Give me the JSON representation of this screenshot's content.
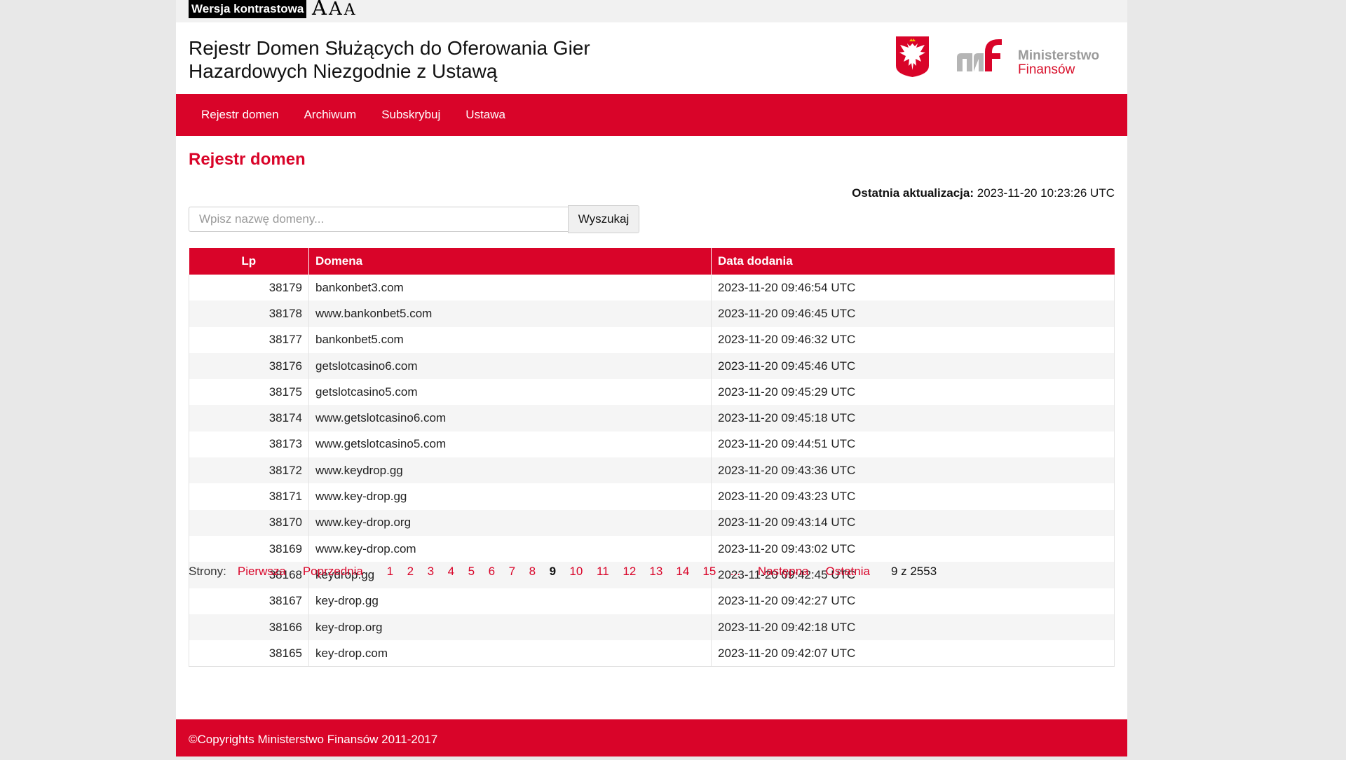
{
  "accessibility": {
    "contrast_label": "Wersja kontrastowa",
    "font_sizes": [
      "A",
      "A",
      "A"
    ]
  },
  "header": {
    "title": "Rejestr Domen Służących do Oferowania Gier Hazardowych Niezgodnie z Ustawą",
    "ministry_line1": "Ministerstwo",
    "ministry_line2": "Finansów",
    "brand_color": "#d90429"
  },
  "nav": {
    "items": [
      "Rejestr domen",
      "Archiwum",
      "Subskrybuj",
      "Ustawa"
    ]
  },
  "main": {
    "heading": "Rejestr domen",
    "last_update_label": "Ostatnia aktualizacja:",
    "last_update_value": "2023-11-20 10:23:26 UTC",
    "search_placeholder": "Wpisz nazwę domeny...",
    "search_button": "Wyszukaj"
  },
  "table": {
    "columns": [
      "Lp",
      "Domena",
      "Data dodania"
    ],
    "rows": [
      [
        "38179",
        "bankonbet3.com",
        "2023-11-20 09:46:54 UTC"
      ],
      [
        "38178",
        "www.bankonbet5.com",
        "2023-11-20 09:46:45 UTC"
      ],
      [
        "38177",
        "bankonbet5.com",
        "2023-11-20 09:46:32 UTC"
      ],
      [
        "38176",
        "getslotcasino6.com",
        "2023-11-20 09:45:46 UTC"
      ],
      [
        "38175",
        "getslotcasino5.com",
        "2023-11-20 09:45:29 UTC"
      ],
      [
        "38174",
        "www.getslotcasino6.com",
        "2023-11-20 09:45:18 UTC"
      ],
      [
        "38173",
        "www.getslotcasino5.com",
        "2023-11-20 09:44:51 UTC"
      ],
      [
        "38172",
        "www.keydrop.gg",
        "2023-11-20 09:43:36 UTC"
      ],
      [
        "38171",
        "www.key-drop.gg",
        "2023-11-20 09:43:23 UTC"
      ],
      [
        "38170",
        "www.key-drop.org",
        "2023-11-20 09:43:14 UTC"
      ],
      [
        "38169",
        "www.key-drop.com",
        "2023-11-20 09:43:02 UTC"
      ],
      [
        "38168",
        "keydrop.gg",
        "2023-11-20 09:42:45 UTC"
      ],
      [
        "38167",
        "key-drop.gg",
        "2023-11-20 09:42:27 UTC"
      ],
      [
        "38166",
        "key-drop.org",
        "2023-11-20 09:42:18 UTC"
      ],
      [
        "38165",
        "key-drop.com",
        "2023-11-20 09:42:07 UTC"
      ]
    ]
  },
  "pager": {
    "label": "Strony:",
    "first": "Pierwsza",
    "prev": "Poprzednia",
    "pages_before": [
      "1",
      "2",
      "3",
      "4",
      "5",
      "6",
      "7",
      "8"
    ],
    "current": "9",
    "pages_after": [
      "10",
      "11",
      "12",
      "13",
      "14",
      "15"
    ],
    "ellipsis": "...",
    "next": "Następna",
    "last": "Ostatnia",
    "info": "9 z 2553"
  },
  "footer": {
    "copyright": "©Copyrights Ministerstwo Finansów 2011-2017"
  }
}
